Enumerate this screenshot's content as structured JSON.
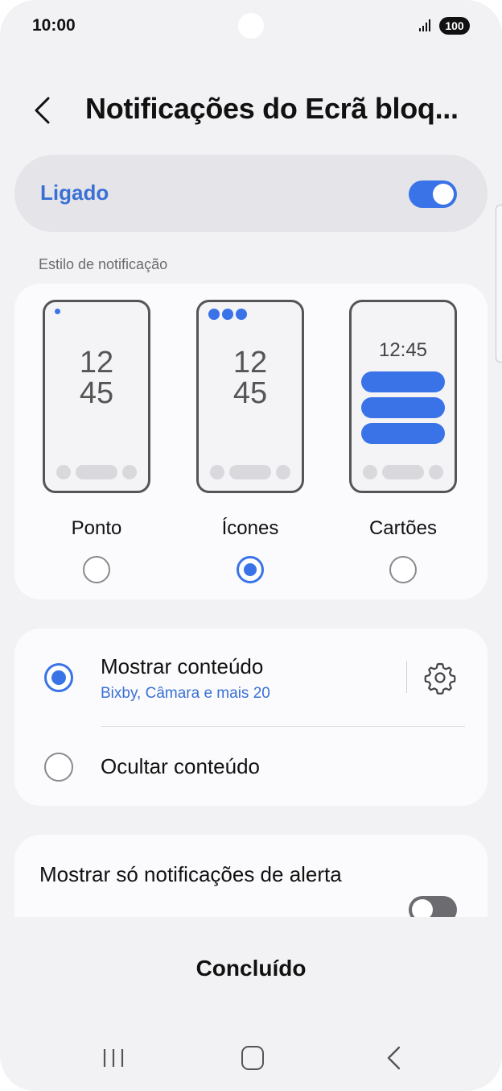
{
  "status_bar": {
    "time": "10:00",
    "battery": "100"
  },
  "header": {
    "title": "Notificações do Ecrã bloq..."
  },
  "master": {
    "label": "Ligado",
    "enabled": true
  },
  "style_section": {
    "label": "Estilo de notificação",
    "options": [
      {
        "label": "Ponto",
        "clock_line1": "12",
        "clock_line2": "45",
        "selected": false
      },
      {
        "label": "Ícones",
        "clock_line1": "12",
        "clock_line2": "45",
        "selected": true
      },
      {
        "label": "Cartões",
        "clock": "12:45",
        "selected": false
      }
    ]
  },
  "content_section": {
    "show": {
      "title": "Mostrar conteúdo",
      "subtitle": "Bixby, Câmara e mais 20",
      "selected": true
    },
    "hide": {
      "title": "Ocultar conteúdo",
      "selected": false
    }
  },
  "alert_only": {
    "label": "Mostrar só notificações de alerta",
    "enabled": false
  },
  "done_label": "Concluído",
  "colors": {
    "accent": "#3a73e8",
    "background": "#f2f2f4",
    "card": "#fbfbfd"
  }
}
